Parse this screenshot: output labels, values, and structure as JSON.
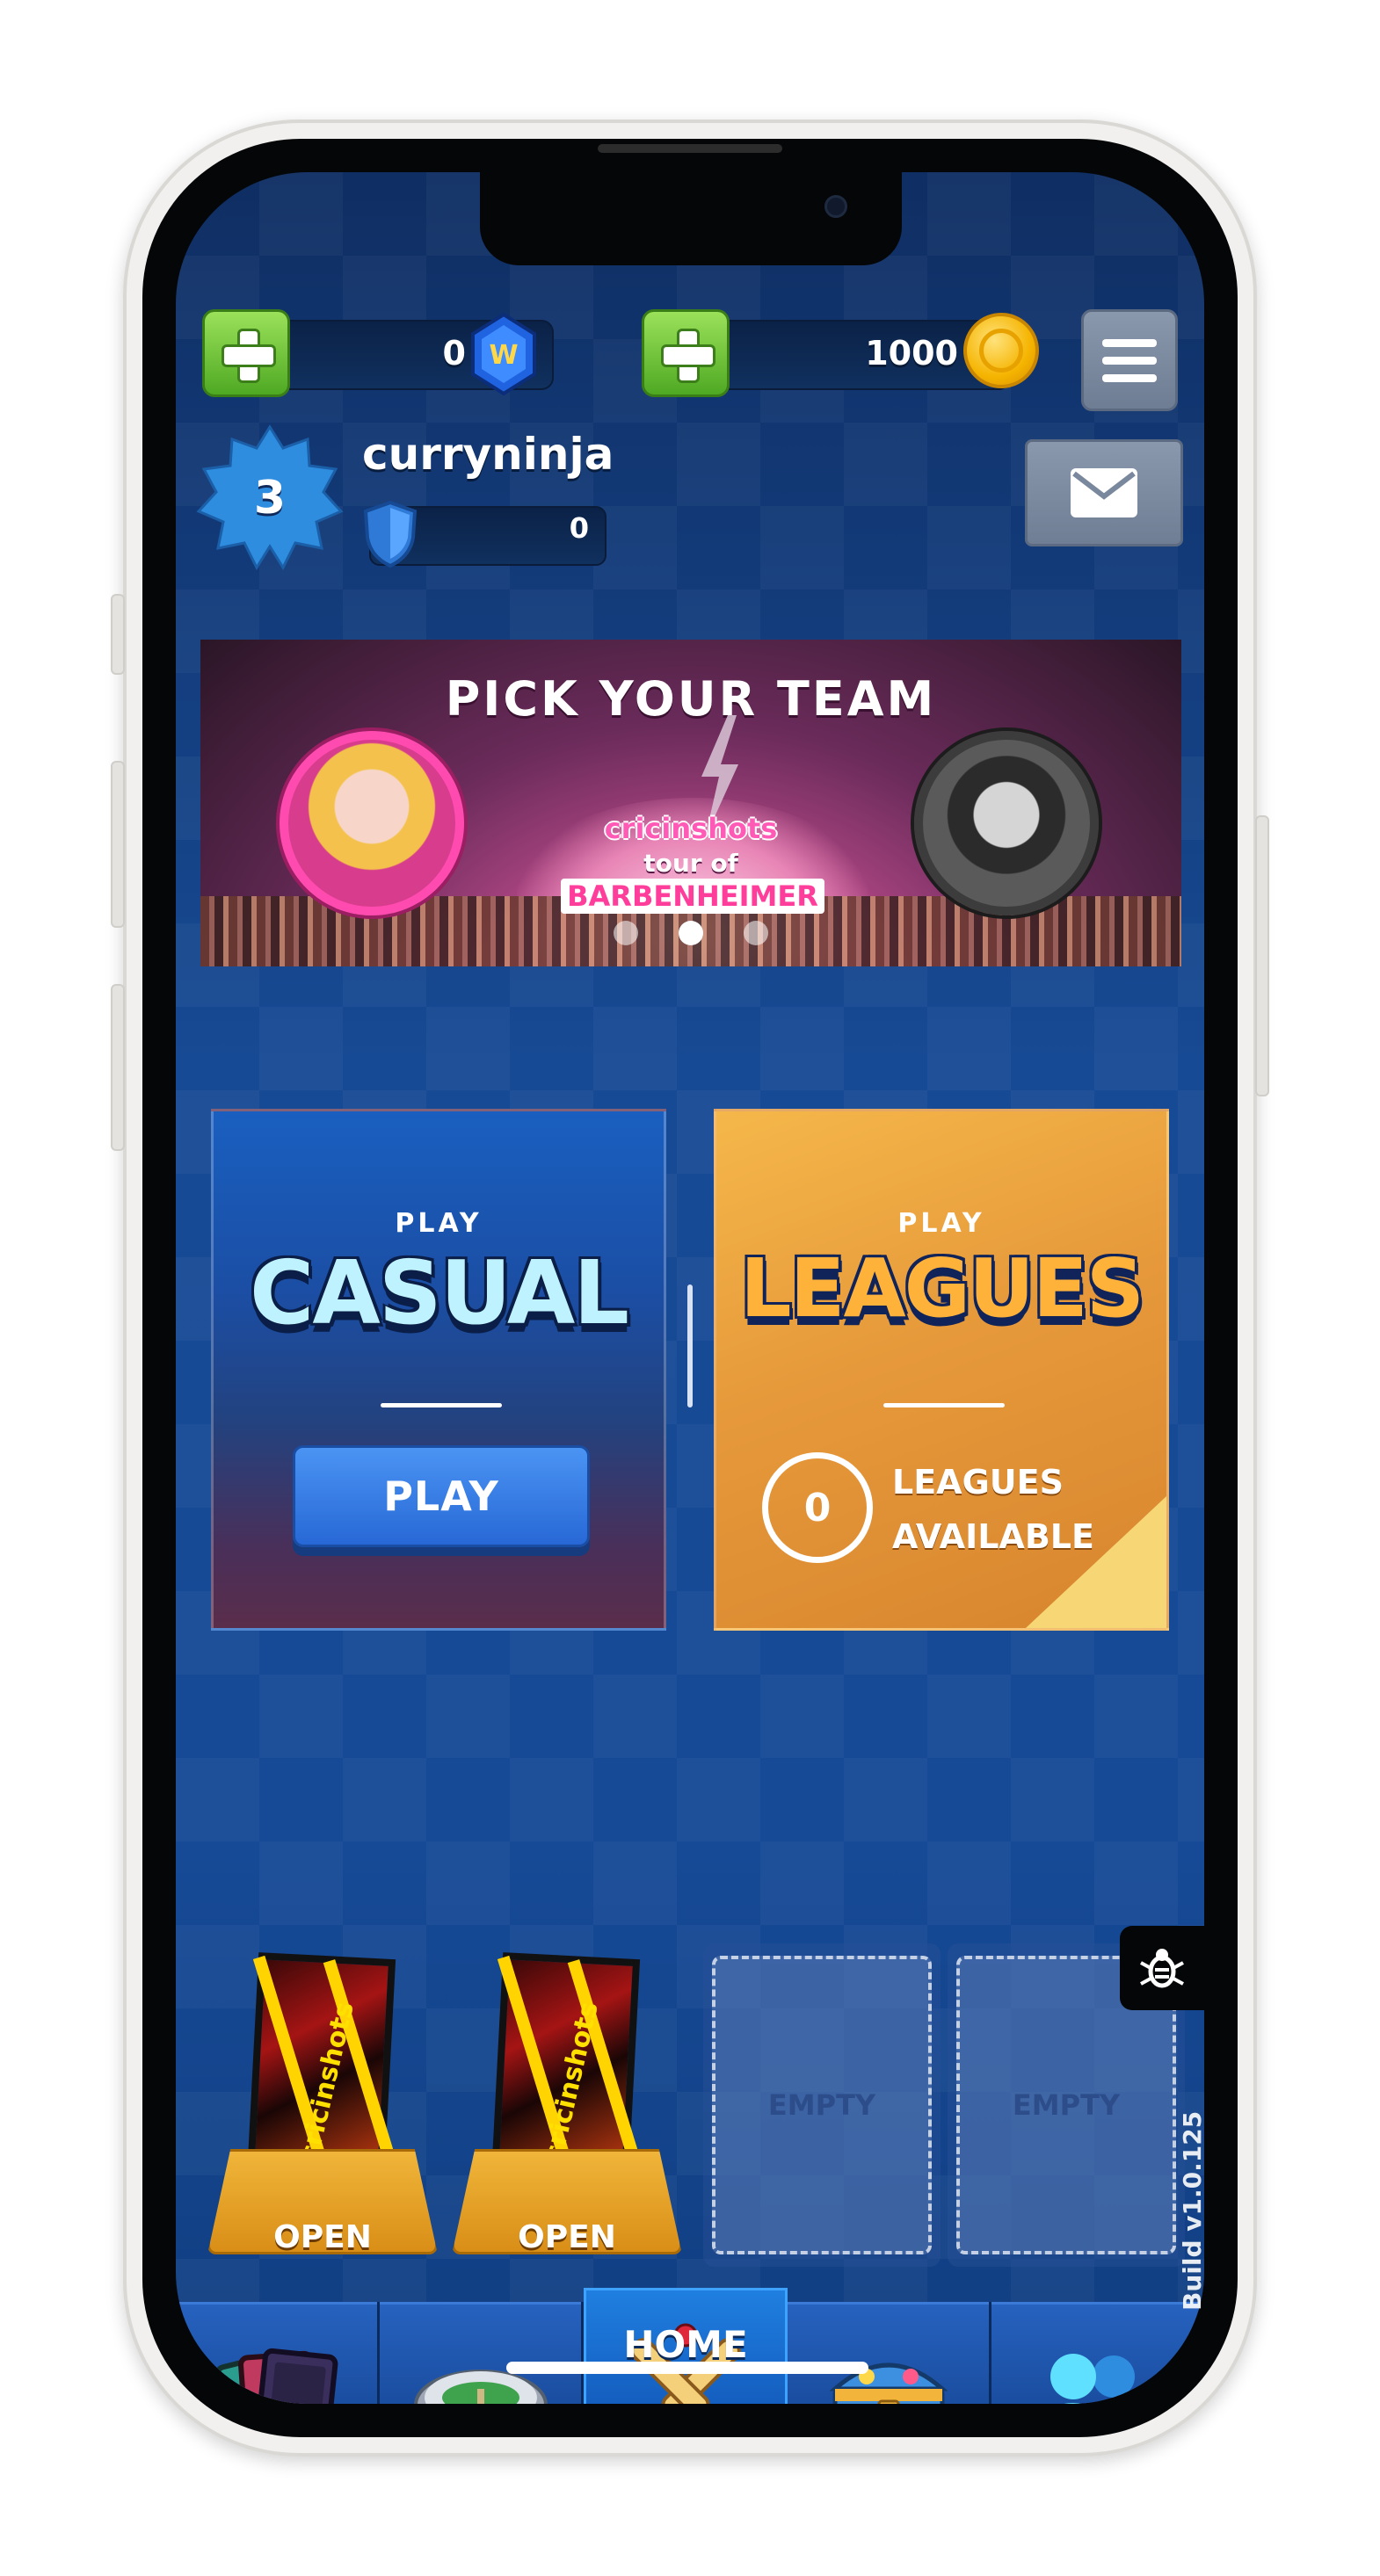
{
  "currency": {
    "gems_value": "0",
    "gem_icon_letter": "W",
    "coins_value": "1000"
  },
  "profile": {
    "level": "3",
    "username": "curryninja",
    "trophies": "0"
  },
  "banner": {
    "title": "PICK YOUR TEAM",
    "brand": "cricinshots",
    "tour_of": "tour of",
    "tour_name": "BARBENHEIMER",
    "page_count": 3,
    "active_page": 2
  },
  "modes": {
    "casual": {
      "play_tag": "PLAY",
      "title": "CASUAL",
      "button": "PLAY"
    },
    "leagues": {
      "play_tag": "PLAY",
      "title": "LEAGUES",
      "count": "0",
      "line1": "LEAGUES",
      "line2": "AVAILABLE"
    }
  },
  "packs": [
    {
      "brand": "cricinshots",
      "label": "OPEN"
    },
    {
      "brand": "cricinshots",
      "label": "OPEN"
    },
    {
      "label": "EMPTY"
    },
    {
      "label": "EMPTY"
    }
  ],
  "nav": {
    "home_label": "HOME",
    "build": "Build v1.0.125"
  },
  "colors": {
    "accent_blue": "#2768d6",
    "plus_green": "#4fa923",
    "coin_gold": "#f5b400",
    "leagues_orange": "#e6993a",
    "banner_pink": "#ff3e9c"
  }
}
